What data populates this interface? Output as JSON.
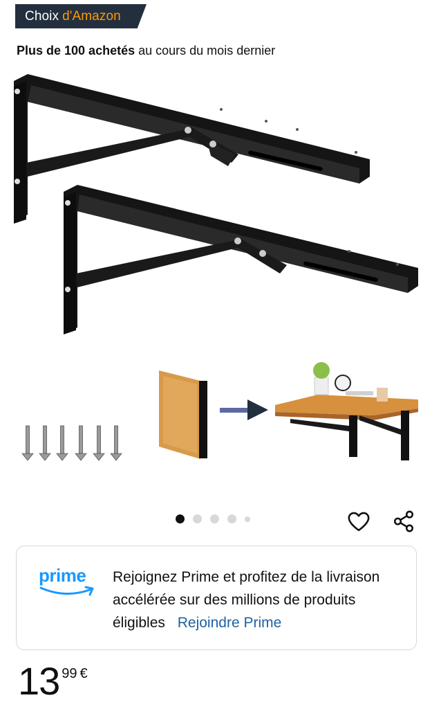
{
  "badge": {
    "prefix": "Choix",
    "brand": "d'Amazon"
  },
  "bought": {
    "bold": "Plus de 100 achetés",
    "rest": "au cours du mois dernier"
  },
  "gallery": {
    "dot_count": 5,
    "active_index": 0
  },
  "icons": {
    "favorite": "heart-icon",
    "share": "share-icon"
  },
  "prime": {
    "logo_text": "prime",
    "message": "Rejoignez Prime et profitez de la livraison accélérée sur des millions de produits éligibles",
    "link": "Rejoindre Prime"
  },
  "price": {
    "whole": "13",
    "fraction": "99",
    "currency": "€"
  },
  "colors": {
    "badge_bg": "#232f3e",
    "badge_accent": "#ff9900",
    "prime_blue": "#1a98ff",
    "link": "#2162a1"
  }
}
